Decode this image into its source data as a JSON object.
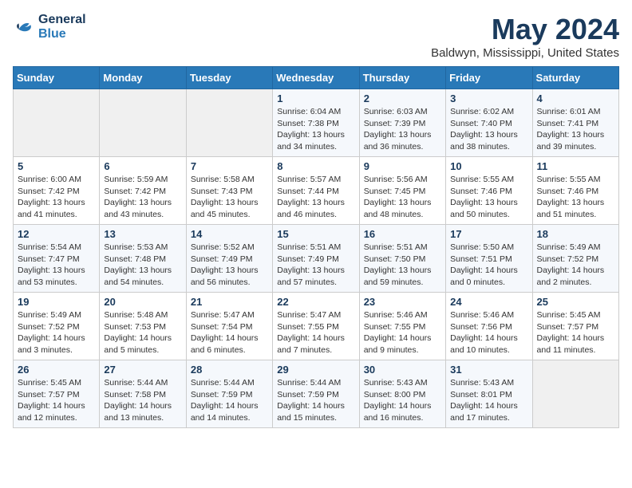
{
  "header": {
    "logo_line1": "General",
    "logo_line2": "Blue",
    "month": "May 2024",
    "location": "Baldwyn, Mississippi, United States"
  },
  "days_of_week": [
    "Sunday",
    "Monday",
    "Tuesday",
    "Wednesday",
    "Thursday",
    "Friday",
    "Saturday"
  ],
  "weeks": [
    [
      {
        "num": "",
        "info": ""
      },
      {
        "num": "",
        "info": ""
      },
      {
        "num": "",
        "info": ""
      },
      {
        "num": "1",
        "info": "Sunrise: 6:04 AM\nSunset: 7:38 PM\nDaylight: 13 hours\nand 34 minutes."
      },
      {
        "num": "2",
        "info": "Sunrise: 6:03 AM\nSunset: 7:39 PM\nDaylight: 13 hours\nand 36 minutes."
      },
      {
        "num": "3",
        "info": "Sunrise: 6:02 AM\nSunset: 7:40 PM\nDaylight: 13 hours\nand 38 minutes."
      },
      {
        "num": "4",
        "info": "Sunrise: 6:01 AM\nSunset: 7:41 PM\nDaylight: 13 hours\nand 39 minutes."
      }
    ],
    [
      {
        "num": "5",
        "info": "Sunrise: 6:00 AM\nSunset: 7:42 PM\nDaylight: 13 hours\nand 41 minutes."
      },
      {
        "num": "6",
        "info": "Sunrise: 5:59 AM\nSunset: 7:42 PM\nDaylight: 13 hours\nand 43 minutes."
      },
      {
        "num": "7",
        "info": "Sunrise: 5:58 AM\nSunset: 7:43 PM\nDaylight: 13 hours\nand 45 minutes."
      },
      {
        "num": "8",
        "info": "Sunrise: 5:57 AM\nSunset: 7:44 PM\nDaylight: 13 hours\nand 46 minutes."
      },
      {
        "num": "9",
        "info": "Sunrise: 5:56 AM\nSunset: 7:45 PM\nDaylight: 13 hours\nand 48 minutes."
      },
      {
        "num": "10",
        "info": "Sunrise: 5:55 AM\nSunset: 7:46 PM\nDaylight: 13 hours\nand 50 minutes."
      },
      {
        "num": "11",
        "info": "Sunrise: 5:55 AM\nSunset: 7:46 PM\nDaylight: 13 hours\nand 51 minutes."
      }
    ],
    [
      {
        "num": "12",
        "info": "Sunrise: 5:54 AM\nSunset: 7:47 PM\nDaylight: 13 hours\nand 53 minutes."
      },
      {
        "num": "13",
        "info": "Sunrise: 5:53 AM\nSunset: 7:48 PM\nDaylight: 13 hours\nand 54 minutes."
      },
      {
        "num": "14",
        "info": "Sunrise: 5:52 AM\nSunset: 7:49 PM\nDaylight: 13 hours\nand 56 minutes."
      },
      {
        "num": "15",
        "info": "Sunrise: 5:51 AM\nSunset: 7:49 PM\nDaylight: 13 hours\nand 57 minutes."
      },
      {
        "num": "16",
        "info": "Sunrise: 5:51 AM\nSunset: 7:50 PM\nDaylight: 13 hours\nand 59 minutes."
      },
      {
        "num": "17",
        "info": "Sunrise: 5:50 AM\nSunset: 7:51 PM\nDaylight: 14 hours\nand 0 minutes."
      },
      {
        "num": "18",
        "info": "Sunrise: 5:49 AM\nSunset: 7:52 PM\nDaylight: 14 hours\nand 2 minutes."
      }
    ],
    [
      {
        "num": "19",
        "info": "Sunrise: 5:49 AM\nSunset: 7:52 PM\nDaylight: 14 hours\nand 3 minutes."
      },
      {
        "num": "20",
        "info": "Sunrise: 5:48 AM\nSunset: 7:53 PM\nDaylight: 14 hours\nand 5 minutes."
      },
      {
        "num": "21",
        "info": "Sunrise: 5:47 AM\nSunset: 7:54 PM\nDaylight: 14 hours\nand 6 minutes."
      },
      {
        "num": "22",
        "info": "Sunrise: 5:47 AM\nSunset: 7:55 PM\nDaylight: 14 hours\nand 7 minutes."
      },
      {
        "num": "23",
        "info": "Sunrise: 5:46 AM\nSunset: 7:55 PM\nDaylight: 14 hours\nand 9 minutes."
      },
      {
        "num": "24",
        "info": "Sunrise: 5:46 AM\nSunset: 7:56 PM\nDaylight: 14 hours\nand 10 minutes."
      },
      {
        "num": "25",
        "info": "Sunrise: 5:45 AM\nSunset: 7:57 PM\nDaylight: 14 hours\nand 11 minutes."
      }
    ],
    [
      {
        "num": "26",
        "info": "Sunrise: 5:45 AM\nSunset: 7:57 PM\nDaylight: 14 hours\nand 12 minutes."
      },
      {
        "num": "27",
        "info": "Sunrise: 5:44 AM\nSunset: 7:58 PM\nDaylight: 14 hours\nand 13 minutes."
      },
      {
        "num": "28",
        "info": "Sunrise: 5:44 AM\nSunset: 7:59 PM\nDaylight: 14 hours\nand 14 minutes."
      },
      {
        "num": "29",
        "info": "Sunrise: 5:44 AM\nSunset: 7:59 PM\nDaylight: 14 hours\nand 15 minutes."
      },
      {
        "num": "30",
        "info": "Sunrise: 5:43 AM\nSunset: 8:00 PM\nDaylight: 14 hours\nand 16 minutes."
      },
      {
        "num": "31",
        "info": "Sunrise: 5:43 AM\nSunset: 8:01 PM\nDaylight: 14 hours\nand 17 minutes."
      },
      {
        "num": "",
        "info": ""
      }
    ]
  ]
}
